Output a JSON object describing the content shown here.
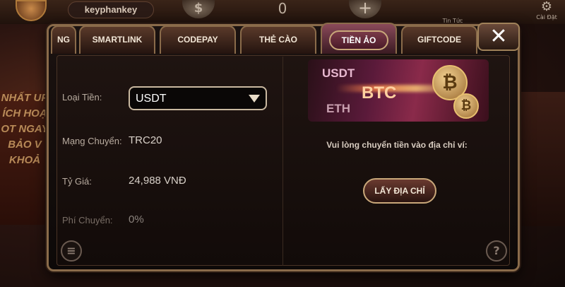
{
  "background": {
    "username": "keyphankey",
    "coin_symbol": "$",
    "balance": "0",
    "plus_symbol": "+",
    "news_label": "Tin Tức",
    "settings_label": "Cài Đặt",
    "banner_text": "NHẤT UP ÍCH HOẠ OT NGAY BẢO V KHOẢ"
  },
  "tabs": [
    {
      "label": "NG",
      "active": false
    },
    {
      "label": "SMARTLINK",
      "active": false
    },
    {
      "label": "CODEPAY",
      "active": false
    },
    {
      "label": "THẺ CÀO",
      "active": false
    },
    {
      "label": "TIỀN ẢO",
      "active": true
    },
    {
      "label": "GIFTCODE",
      "active": false
    }
  ],
  "close_label": "✕",
  "form": {
    "currency_label": "Loại Tiền:",
    "currency_value": "USDT",
    "network_label": "Mạng Chuyển:",
    "network_value": "TRC20",
    "rate_label": "Tỷ Giá:",
    "rate_value": "24,988 VNĐ",
    "fee_label": "Phí Chuyển:",
    "fee_value": "0%"
  },
  "banner": {
    "usdt": "USDT",
    "btc": "BTC",
    "eth": "ETH",
    "coin_symbol": "₿"
  },
  "instruction": "Vui lòng chuyển tiền vào địa chỉ ví:",
  "get_address_button": "LẤY ĐỊA CHỈ",
  "help_symbol": "?"
}
